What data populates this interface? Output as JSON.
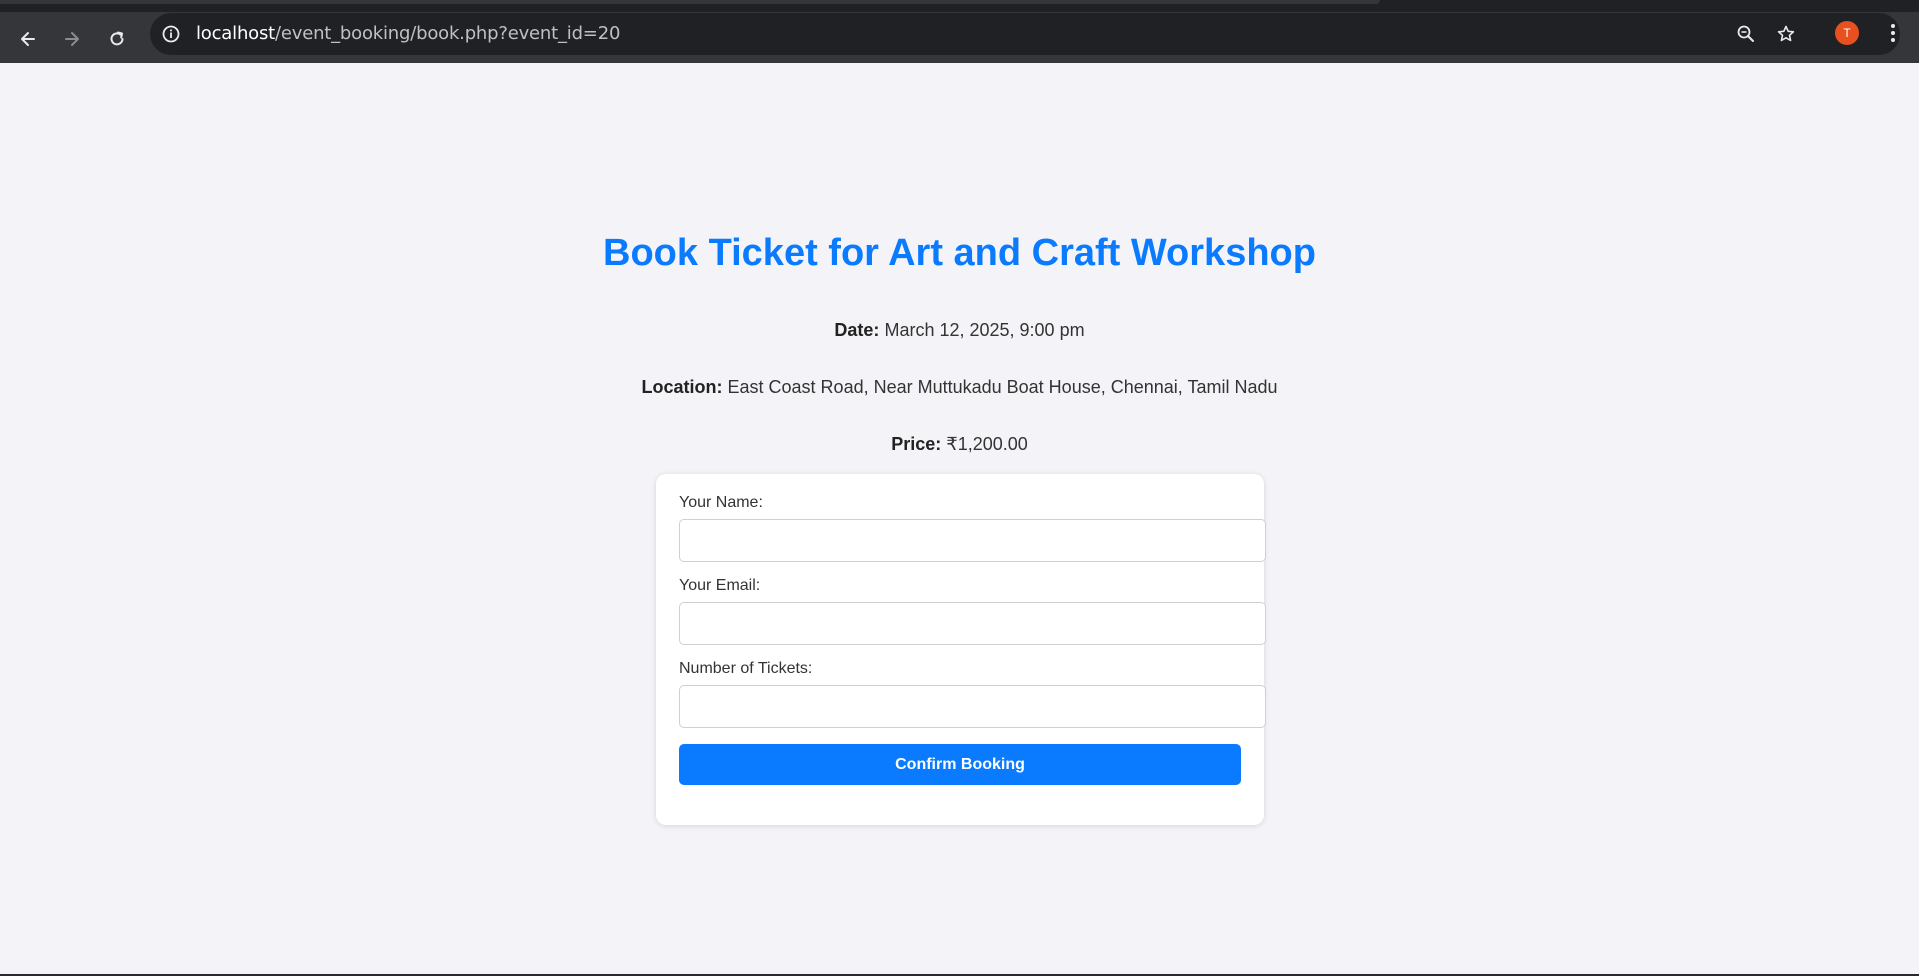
{
  "browser": {
    "url_host": "localhost",
    "url_path": "/event_booking/book.php?event_id=20",
    "profile_initial": "T",
    "icons": {
      "back": "back-arrow-icon",
      "forward": "forward-arrow-icon",
      "reload": "reload-icon",
      "info": "site-info-icon",
      "zoom": "zoom-icon",
      "bookmark": "star-icon",
      "menu": "kebab-menu-icon"
    }
  },
  "event": {
    "title": "Book Ticket for Art and Craft Workshop",
    "date_label": "Date:",
    "date_value": "March 12, 2025, 9:00 pm",
    "location_label": "Location:",
    "location_value": "East Coast Road, Near Muttukadu Boat House, Chennai, Tamil Nadu",
    "price_label": "Price:",
    "price_value": "₹1,200.00"
  },
  "form": {
    "name_label": "Your Name:",
    "name_value": "",
    "email_label": "Your Email:",
    "email_value": "",
    "tickets_label": "Number of Tickets:",
    "tickets_value": "",
    "submit_label": "Confirm Booking"
  },
  "colors": {
    "accent": "#0a7bff",
    "page_bg": "#f4f4f8",
    "chrome_bg": "#35363a",
    "profile": "#e8501f"
  }
}
